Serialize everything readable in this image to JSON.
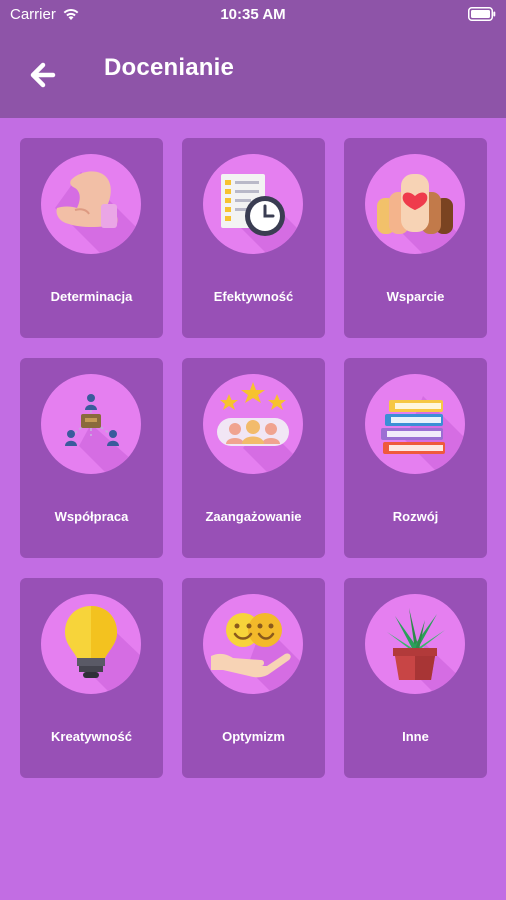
{
  "status_bar": {
    "carrier": "Carrier",
    "time": "10:35 AM"
  },
  "header": {
    "title": "Docenianie",
    "back_icon": "arrow-left-icon"
  },
  "categories": [
    {
      "label": "Determinacja",
      "icon": "flexed-arm-icon"
    },
    {
      "label": "Efektywność",
      "icon": "checklist-clock-icon"
    },
    {
      "label": "Wsparcie",
      "icon": "raised-hands-heart-icon"
    },
    {
      "label": "Współpraca",
      "icon": "team-network-icon"
    },
    {
      "label": "Zaangażowanie",
      "icon": "people-stars-icon"
    },
    {
      "label": "Rozwój",
      "icon": "book-stack-icon"
    },
    {
      "label": "Kreatywność",
      "icon": "light-bulb-icon"
    },
    {
      "label": "Optymizm",
      "icon": "smiling-faces-hand-icon"
    },
    {
      "label": "Inne",
      "icon": "potted-plant-icon"
    }
  ],
  "colors": {
    "background": "#c26de3",
    "header": "#8e54a8",
    "card": "#9850b6",
    "icon_circle": "#e57ff0"
  }
}
